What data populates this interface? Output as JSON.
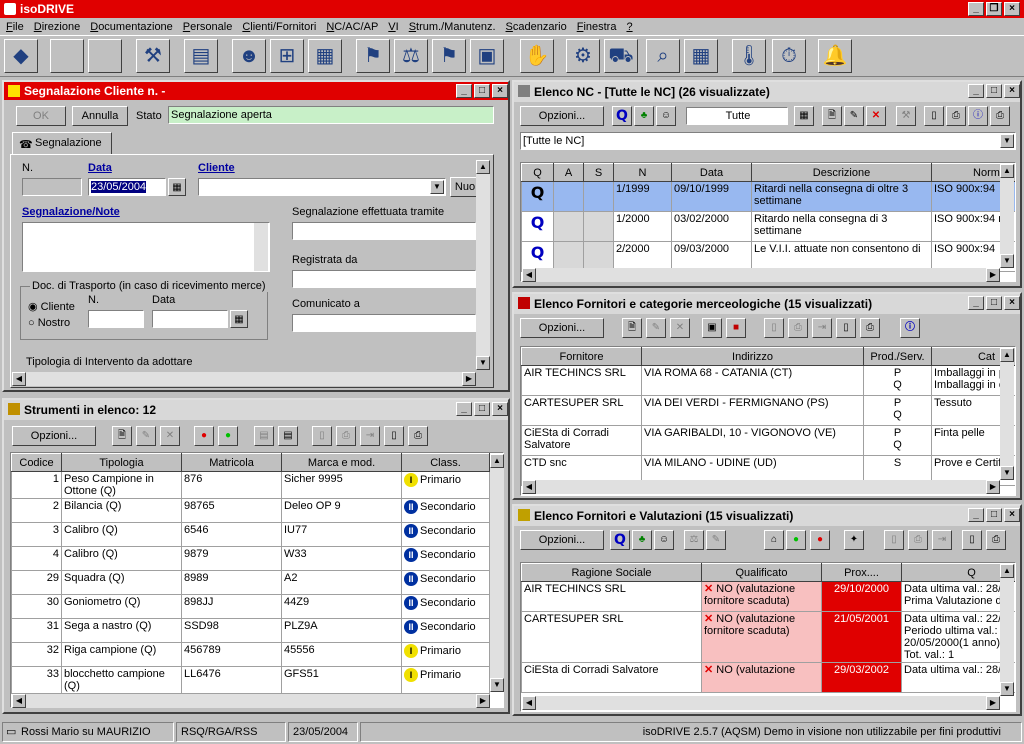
{
  "app": {
    "title": "isoDRIVE"
  },
  "menu": [
    "File",
    "Direzione",
    "Documentazione",
    "Personale",
    "Clienti/Fornitori",
    "NC/AC/AP",
    "VI",
    "Strum./Manutenz.",
    "Scadenzario",
    "Finestra",
    "?"
  ],
  "toolbar_icons": [
    "diskette-icon",
    "blank-icon",
    "blank-icon",
    "gavel-icon",
    "book-icon",
    "person-icon",
    "org-chart-icon",
    "presentation-icon",
    "handtruck-icon",
    "scales-icon",
    "handtruck-yellow-icon",
    "boxes-icon",
    "handshake-icon",
    "mixer-icon",
    "car-icon",
    "magnifier-icon",
    "calendar-icon",
    "thermometer-icon",
    "stopwatch-icon",
    "bell-icon"
  ],
  "segnalazione": {
    "title": "Segnalazione Cliente n.  -",
    "ok": "OK",
    "annulla": "Annulla",
    "stato_label": "Stato",
    "stato_value": "Segnalazione aperta",
    "tab": "Segnalazione",
    "n_label": "N.",
    "data_label": "Data",
    "data_value": "23/05/2004",
    "cliente_label": "Cliente",
    "nuovo": "Nuo",
    "note_label": "Segnalazione/Note",
    "tramite_label": "Segnalazione effettuata tramite",
    "registrata_label": "Registrata da",
    "comunicato_label": "Comunicato a",
    "doc_group": "Doc. di Trasporto (in caso di ricevimento merce)",
    "radio_cliente": "Cliente",
    "radio_nostro": "Nostro",
    "doc_n": "N.",
    "doc_data": "Data",
    "tipologia_label": "Tipologia di Intervento da adottare"
  },
  "strumenti": {
    "title": "Strumenti in elenco: 12",
    "opzioni": "Opzioni...",
    "columns": [
      "Codice",
      "Tipologia",
      "Matricola",
      "Marca e mod.",
      "Class."
    ],
    "rows": [
      [
        "1",
        "Peso Campione in Ottone (Q)",
        "876",
        "Sicher 9995",
        "I",
        "Primario"
      ],
      [
        "2",
        "Bilancia (Q)",
        "98765",
        "Deleo OP 9",
        "II",
        "Secondario"
      ],
      [
        "3",
        "Calibro (Q)",
        "6546",
        "IU77",
        "II",
        "Secondario"
      ],
      [
        "4",
        "Calibro (Q)",
        "9879",
        "W33",
        "II",
        "Secondario"
      ],
      [
        "29",
        "Squadra (Q)",
        "8989",
        "A2",
        "II",
        "Secondario"
      ],
      [
        "30",
        "Goniometro (Q)",
        "898JJ",
        "44Z9",
        "II",
        "Secondario"
      ],
      [
        "31",
        "Sega a nastro (Q)",
        "SSD98",
        "PLZ9A",
        "II",
        "Secondario"
      ],
      [
        "32",
        "Riga campione (Q)",
        "456789",
        "45556",
        "I",
        "Primario"
      ],
      [
        "33",
        "blocchetto campione (Q)",
        "LL6476",
        "GFS51",
        "I",
        "Primario"
      ]
    ]
  },
  "nc": {
    "title": "Elenco NC - [Tutte le NC] (26 visualizzate)",
    "opzioni": "Opzioni...",
    "filter": "Tutte",
    "combo": "[Tutte le NC]",
    "columns": [
      "Q",
      "A",
      "S",
      "N",
      "Data",
      "Descrizione",
      "Norm"
    ],
    "rows": [
      [
        "Q",
        "",
        "",
        "1/1999",
        "09/10/1999",
        "Ritardi nella consegna di oltre 3 settimane",
        "ISO 900x:94"
      ],
      [
        "Q",
        "",
        "",
        "1/2000",
        "03/02/2000",
        "Ritardo nella consegna di 3 settimane",
        "ISO 900x:94 n"
      ],
      [
        "Q",
        "",
        "",
        "2/2000",
        "09/03/2000",
        "Le V.I.I. attuate non consentono di",
        "ISO 900x:94"
      ]
    ]
  },
  "fornitori": {
    "title": "Elenco Fornitori e categorie merceologiche (15 visualizzati)",
    "opzioni": "Opzioni...",
    "columns": [
      "Fornitore",
      "Indirizzo",
      "Prod./Serv.",
      "Cat"
    ],
    "rows": [
      [
        "AIR TECHINCS SRL",
        "VIA ROMA 68 - CATANIA (CT)",
        "P\nQ",
        "Imballaggi in p\nImballaggi in c"
      ],
      [
        "CARTESUPER SRL",
        "VIA DEI VERDI - FERMIGNANO (PS)",
        "P\nQ",
        "Tessuto"
      ],
      [
        "CiESta di Corradi Salvatore",
        "VIA GARIBALDI, 10 - VIGONOVO (VE)",
        "P\nQ",
        "Finta pelle"
      ],
      [
        "CTD snc",
        "VIA MILANO - UDINE (UD)",
        "S",
        "Prove e Certif"
      ]
    ]
  },
  "valutazioni": {
    "title": "Elenco Fornitori e Valutazioni (15 visualizzati)",
    "opzioni": "Opzioni...",
    "columns": [
      "Ragione Sociale",
      "Qualificato",
      "Prox....",
      "Q"
    ],
    "rows": [
      [
        "AIR TECHINCS SRL",
        "NO (valutazione fornitore scaduta)",
        "29/10/2000",
        "Data ultima val.: 28/\nPrima Valutazione di"
      ],
      [
        "CARTESUPER SRL",
        "NO (valutazione fornitore scaduta)",
        "21/05/2001",
        "Data ultima val.: 22/\nPeriodo ultima val.: 2\n20/05/2000(1 anno)\nTot. val.: 1"
      ],
      [
        "CiESta di Corradi Salvatore",
        "NO (valutazione",
        "29/03/2002",
        "Data ultima val.: 28/"
      ]
    ]
  },
  "statusbar": {
    "user": "Rossi Mario su MAURIZIO",
    "role": "RSQ/RGA/RSS",
    "date": "23/05/2004",
    "version": "isoDRIVE 2.5.7 (AQSM) Demo in visione non utilizzabile per fini produttivi"
  },
  "colors": {
    "title_red": "#e00000",
    "selected": "#98b8f0",
    "alert_pink": "#f8c0c0",
    "alert_red": "#e00000"
  }
}
